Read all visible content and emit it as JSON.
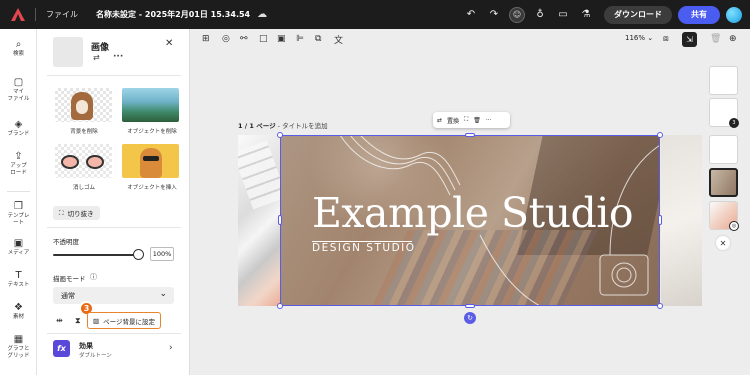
{
  "topbar": {
    "file_menu": "ファイル",
    "doc_title": "名称未設定 - 2025年2月01日 15.34.54",
    "download_label": "ダウンロード",
    "share_label": "共有"
  },
  "rail": [
    {
      "icon": "search-icon",
      "label": "検索"
    },
    {
      "icon": "folder-icon",
      "label": "マイ\nファイル"
    },
    {
      "icon": "brand-icon",
      "label": "ブランド"
    },
    {
      "icon": "upload-icon",
      "label": "アップ\nロード"
    },
    {
      "icon": "template-icon",
      "label": "テンプレ\nート"
    },
    {
      "icon": "media-icon",
      "label": "メディア"
    },
    {
      "icon": "text-icon",
      "label": "テキスト"
    },
    {
      "icon": "elements-icon",
      "label": "素材"
    },
    {
      "icon": "grid-icon",
      "label": "グラフと\nグリッド"
    }
  ],
  "panel": {
    "title": "画像",
    "tiles": [
      {
        "label": "背景を削除"
      },
      {
        "label": "オブジェクトを削除"
      },
      {
        "label": "消しゴム"
      },
      {
        "label": "オブジェクトを挿入"
      }
    ],
    "crop_label": "切り抜き",
    "opacity_label": "不透明度",
    "opacity_value": "100%",
    "opacity_fraction": 1.0,
    "blend_label": "描画モード",
    "blend_value": "通常",
    "step_badge": "3",
    "set_bg_label": "ページ背景に設定",
    "effects_title": "効果",
    "effects_sub": "ダブルトーン"
  },
  "canvas": {
    "zoom": "116%",
    "page_label_bold": "1 / 1 ページ",
    "page_label_rest": " - タイトルを追加",
    "floatbar_replace": "置換",
    "headline": "Example Studio",
    "subheadline": "DESIGN STUDIO"
  },
  "pages": {
    "thumb_badge": "3"
  },
  "colors": {
    "accent": "#4b5cf0",
    "selection": "#5b5ce6",
    "badge": "#e86b18",
    "effects": "#5a48d8"
  }
}
